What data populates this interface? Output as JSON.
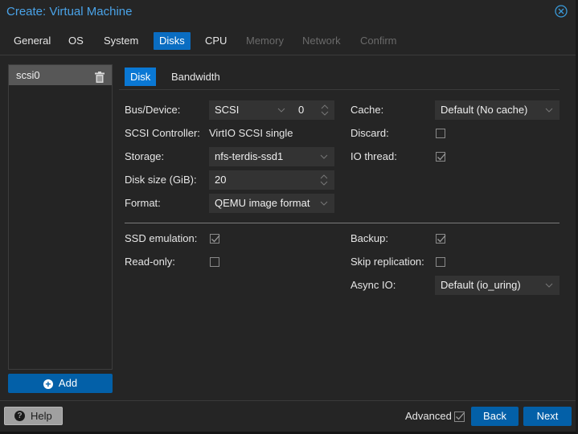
{
  "window": {
    "title": "Create: Virtual Machine",
    "close_icon": "close-circle-icon"
  },
  "tabs": [
    {
      "label": "General",
      "state": "normal"
    },
    {
      "label": "OS",
      "state": "normal"
    },
    {
      "label": "System",
      "state": "normal"
    },
    {
      "label": "Disks",
      "state": "active"
    },
    {
      "label": "CPU",
      "state": "normal"
    },
    {
      "label": "Memory",
      "state": "disabled"
    },
    {
      "label": "Network",
      "state": "disabled"
    },
    {
      "label": "Confirm",
      "state": "disabled"
    }
  ],
  "disk_list": {
    "items": [
      {
        "label": "scsi0",
        "icon": "trash-icon",
        "selected": true
      }
    ],
    "add_label": "Add"
  },
  "subtabs": [
    {
      "label": "Disk",
      "active": true
    },
    {
      "label": "Bandwidth",
      "active": false
    }
  ],
  "form": {
    "bus_device": {
      "label": "Bus/Device:",
      "bus": "SCSI",
      "device": "0"
    },
    "scsi_controller": {
      "label": "SCSI Controller:",
      "value": "VirtIO SCSI single"
    },
    "storage": {
      "label": "Storage:",
      "value": "nfs-terdis-ssd1"
    },
    "disk_size": {
      "label": "Disk size (GiB):",
      "value": "20"
    },
    "format": {
      "label": "Format:",
      "value": "QEMU image format"
    },
    "cache": {
      "label": "Cache:",
      "value": "Default (No cache)"
    },
    "discard": {
      "label": "Discard:",
      "checked": false
    },
    "io_thread": {
      "label": "IO thread:",
      "checked": true
    },
    "ssd_emulation": {
      "label": "SSD emulation:",
      "checked": true
    },
    "read_only": {
      "label": "Read-only:",
      "checked": false
    },
    "backup": {
      "label": "Backup:",
      "checked": true
    },
    "skip_replication": {
      "label": "Skip replication:",
      "checked": false
    },
    "async_io": {
      "label": "Async IO:",
      "value": "Default (io_uring)"
    }
  },
  "footer": {
    "help_label": "Help",
    "advanced_label": "Advanced",
    "advanced_checked": true,
    "back_label": "Back",
    "next_label": "Next"
  },
  "colors": {
    "accent": "#0a78d4",
    "button": "#0360a8",
    "title": "#4aa3e8"
  }
}
